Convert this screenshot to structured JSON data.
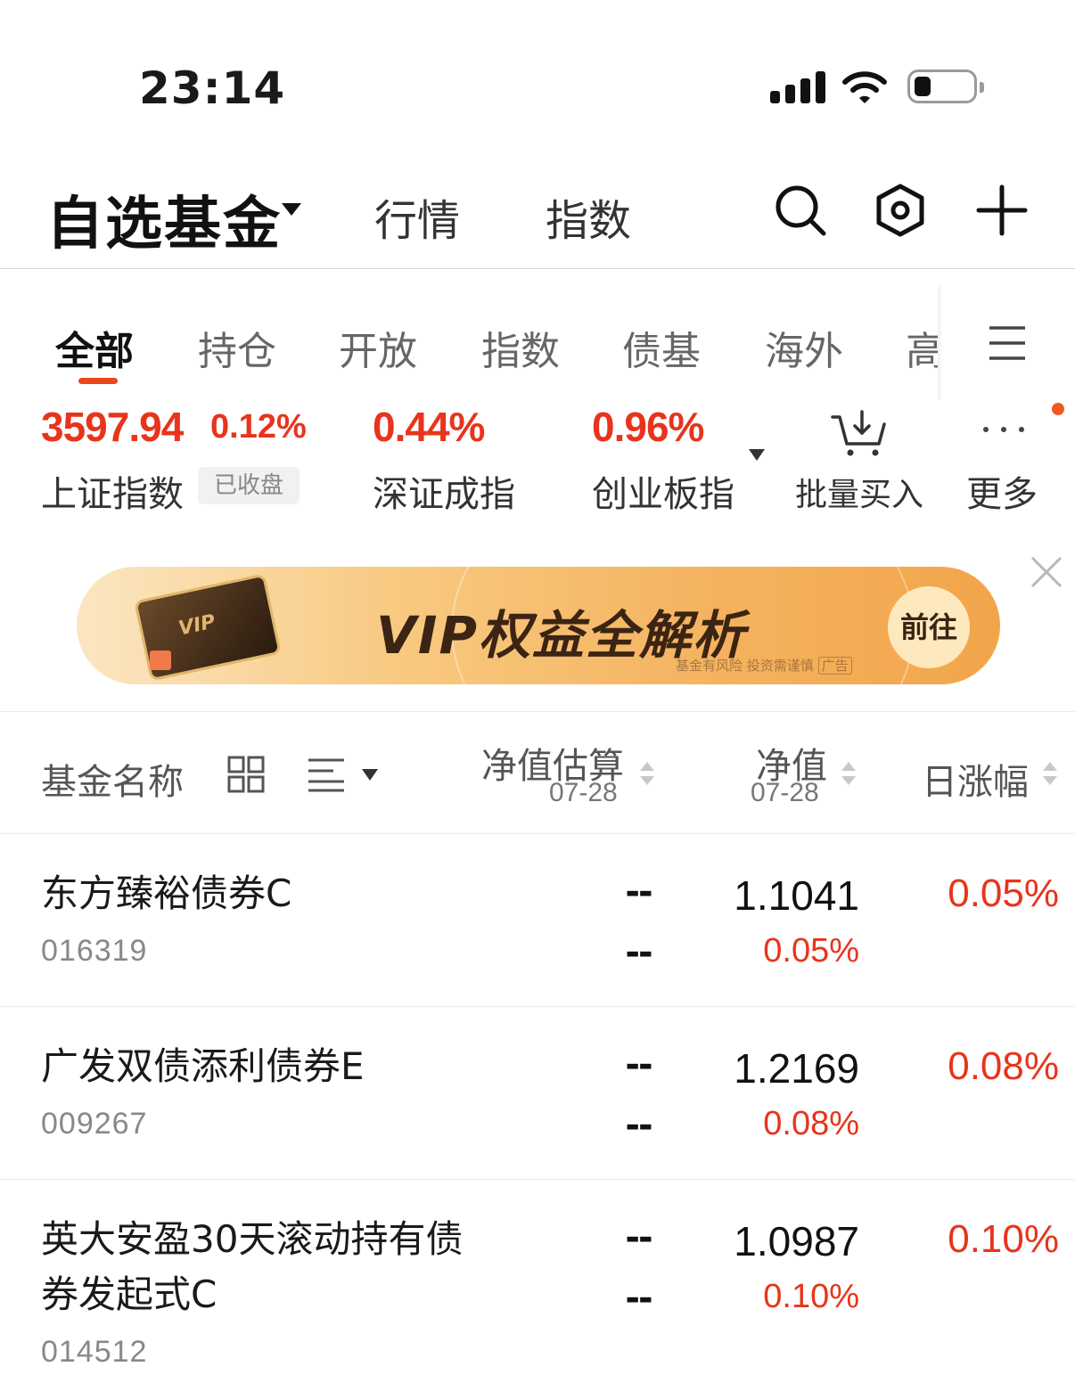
{
  "status_bar": {
    "time": "23:14"
  },
  "header": {
    "title": "自选基金",
    "tabs": [
      "行情",
      "指数"
    ],
    "icons": [
      "search-icon",
      "settings-hexagon-icon",
      "plus-icon"
    ]
  },
  "categories": {
    "items": [
      "全部",
      "持仓",
      "开放",
      "指数",
      "债基",
      "海外",
      "高"
    ],
    "active": "全部",
    "menu_icon": "menu-icon"
  },
  "indices": [
    {
      "name": "上证指数",
      "value": "3597.94",
      "change": "0.12%",
      "badge": "已收盘"
    },
    {
      "name": "深证成指",
      "change": "0.44%"
    },
    {
      "name": "创业板指",
      "change": "0.96%"
    }
  ],
  "index_tools": {
    "batch_buy": "批量买入",
    "more": "更多"
  },
  "banner": {
    "text": "VIP权益全解析",
    "card_text": "VIP",
    "disclaimer": "基金有风险 投资需谨慎",
    "ad_label": "广告",
    "button": "前往"
  },
  "list_header": {
    "name_col": "基金名称",
    "estimate_col": "净值估算",
    "estimate_date": "07-28",
    "nav_col": "净值",
    "nav_date": "07-28",
    "change_col": "日涨幅"
  },
  "funds": [
    {
      "name": "东方臻裕债券C",
      "code": "016319",
      "estimate": "--",
      "estimate_change": "--",
      "nav": "1.1041",
      "nav_change": "0.05%",
      "day_change": "0.05%"
    },
    {
      "name": "广发双债添利债券E",
      "code": "009267",
      "estimate": "--",
      "estimate_change": "--",
      "nav": "1.2169",
      "nav_change": "0.08%",
      "day_change": "0.08%"
    },
    {
      "name": "英大安盈30天滚动持有债券发起式C",
      "code": "014512",
      "estimate": "--",
      "estimate_change": "--",
      "nav": "1.0987",
      "nav_change": "0.10%",
      "day_change": "0.10%"
    }
  ],
  "colors": {
    "up": "#e8341c",
    "accent": "#e8481e"
  }
}
